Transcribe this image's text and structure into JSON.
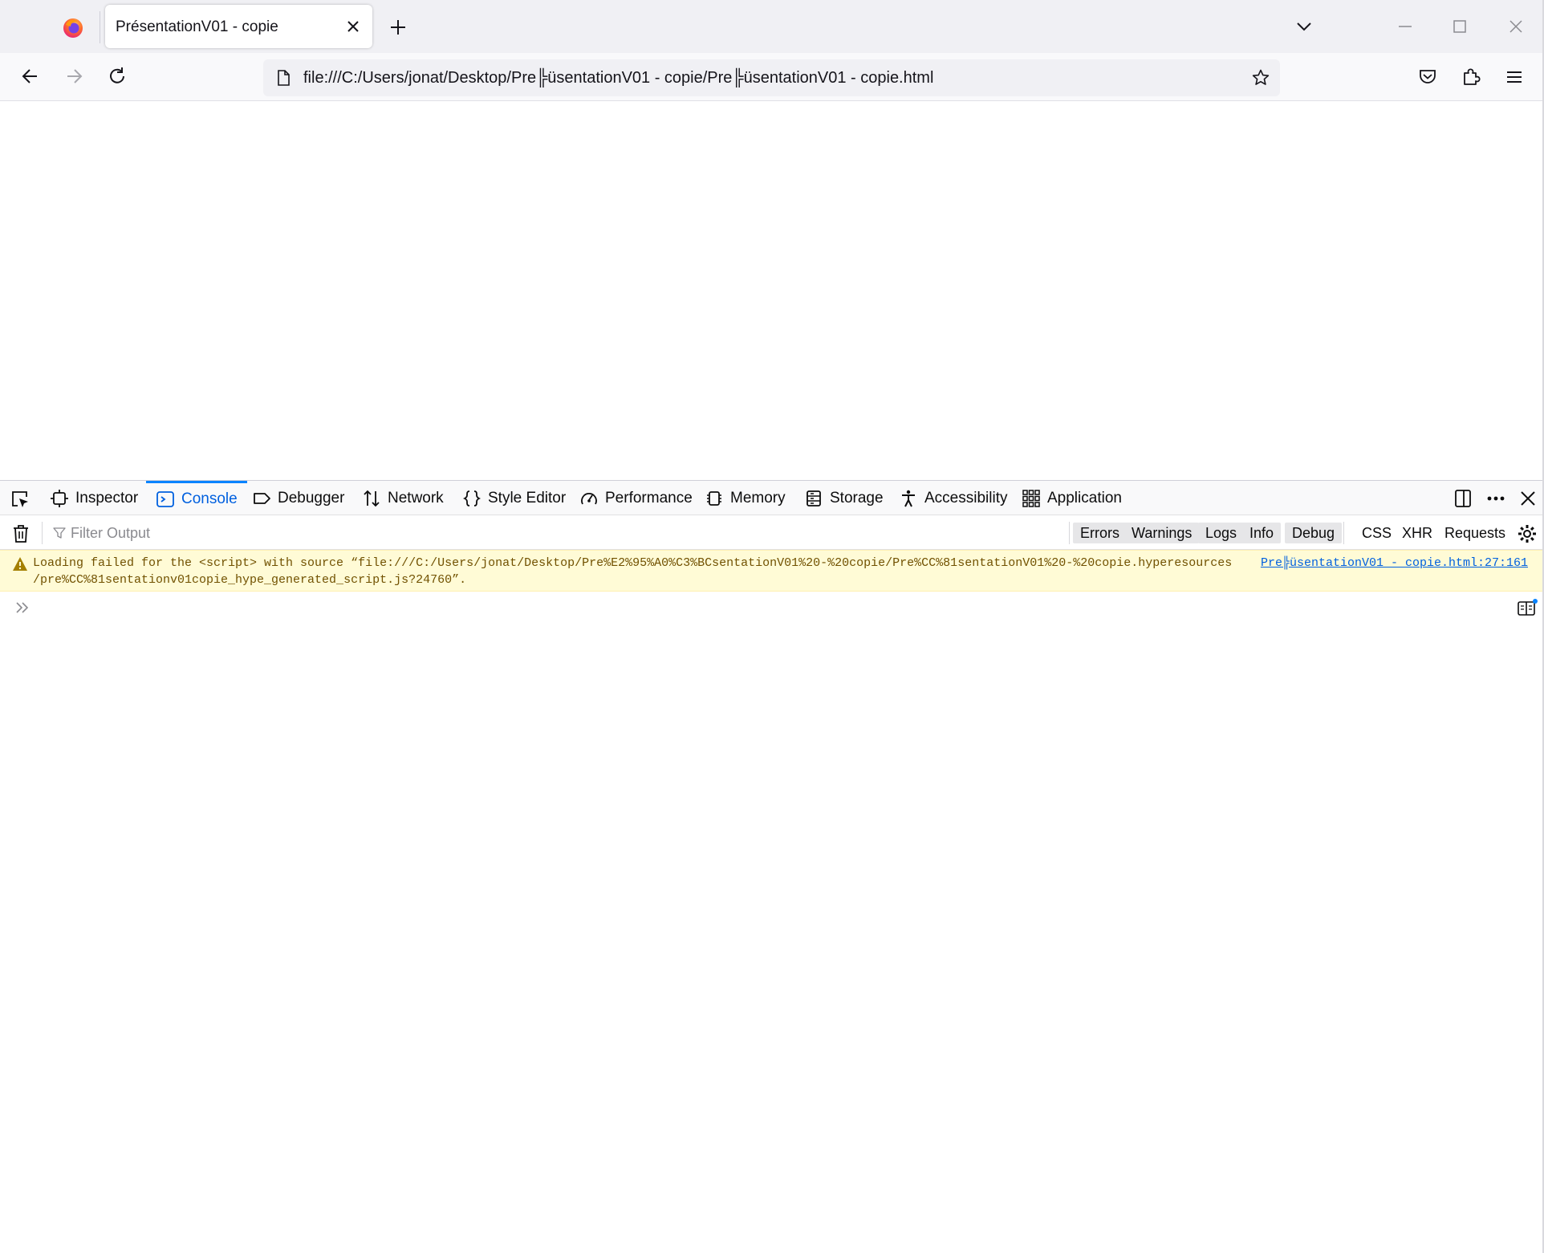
{
  "tab": {
    "title": "PrésentationV01 - copie"
  },
  "url": {
    "value": "file:///C:/Users/jonat/Desktop/Pre╠üsentationV01 - copie/Pre╠üsentationV01 - copie.html"
  },
  "devtools": {
    "tabs": [
      {
        "label": "Inspector",
        "icon": "inspector-icon"
      },
      {
        "label": "Console",
        "icon": "console-icon",
        "active": true
      },
      {
        "label": "Debugger",
        "icon": "debugger-icon"
      },
      {
        "label": "Network",
        "icon": "network-icon"
      },
      {
        "label": "Style Editor",
        "icon": "style-editor-icon"
      },
      {
        "label": "Performance",
        "icon": "performance-icon"
      },
      {
        "label": "Memory",
        "icon": "memory-icon"
      },
      {
        "label": "Storage",
        "icon": "storage-icon"
      },
      {
        "label": "Accessibility",
        "icon": "accessibility-icon"
      },
      {
        "label": "Application",
        "icon": "application-icon"
      }
    ],
    "filter": {
      "placeholder": "Filter Output"
    },
    "levels": [
      "Errors",
      "Warnings",
      "Logs",
      "Info",
      "Debug"
    ],
    "categories": [
      "CSS",
      "XHR",
      "Requests"
    ],
    "messages": [
      {
        "level": "warning",
        "text_line1": "Loading failed for the <script> with source “file:///C:/Users/jonat/Desktop/Pre%E2%95%A0%C3%BCsentationV01%20-%20copie/Pre%CC%81sentationV01%20-%20copie.hyperesources",
        "text_line2": "/pre%CC%81sentationv01copie_hype_generated_script.js?24760”.",
        "source": "Pre╠üsentationV01 - copie.html:27:161"
      }
    ]
  },
  "colors": {
    "accent": "#0060df",
    "warning_bg": "#fffbd6",
    "warning_text": "#715100"
  }
}
